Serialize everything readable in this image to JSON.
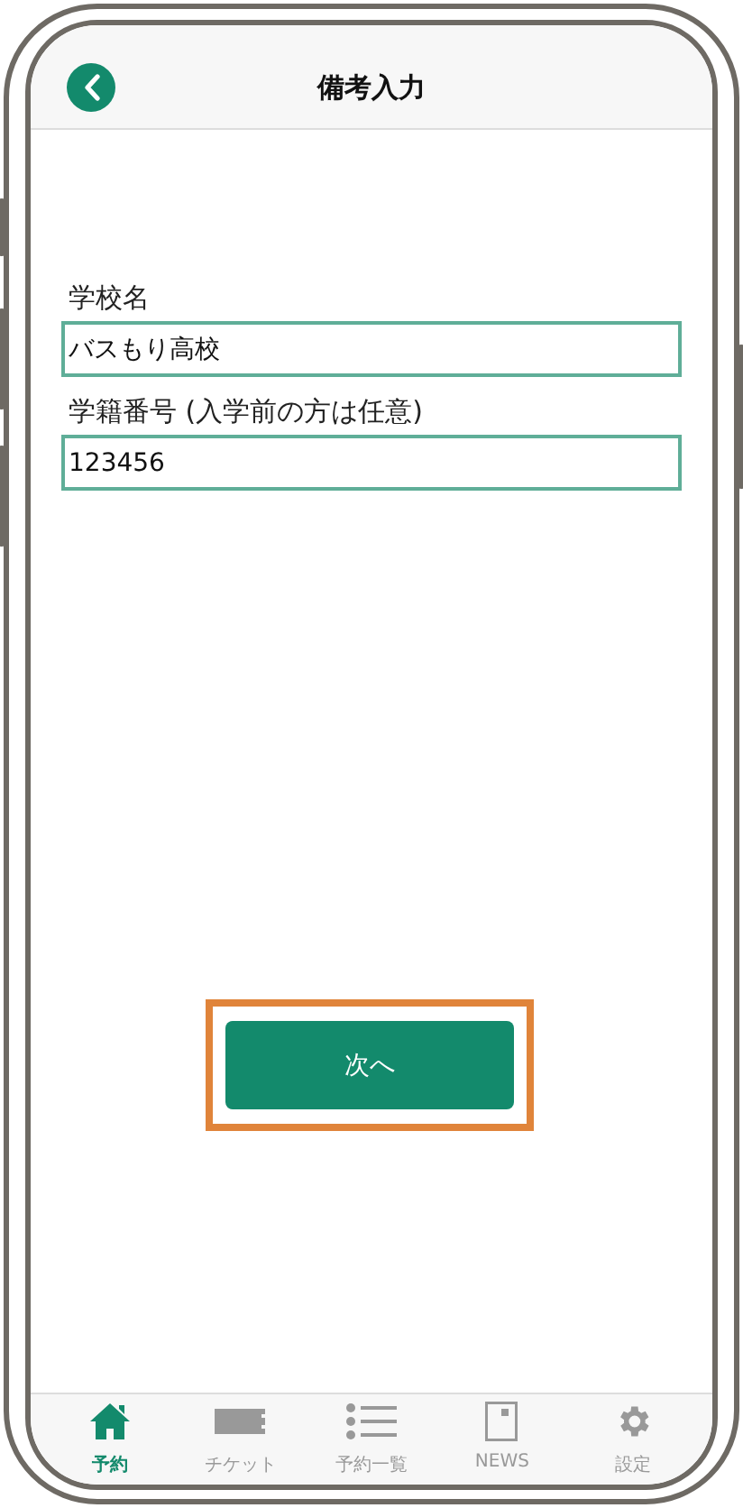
{
  "header": {
    "title": "備考入力"
  },
  "form": {
    "fields": [
      {
        "label": "学校名",
        "value": "バスもり高校"
      },
      {
        "label": "学籍番号 (入学前の方は任意)",
        "value": "123456"
      }
    ]
  },
  "next_button": {
    "label": "次へ",
    "highlighted": true
  },
  "tab_bar": [
    {
      "label": "予約",
      "selected": true
    },
    {
      "label": "チケット",
      "selected": false
    },
    {
      "label": "予約一覧",
      "selected": false
    },
    {
      "label": "NEWS",
      "selected": false
    },
    {
      "label": "設定",
      "selected": false
    }
  ]
}
